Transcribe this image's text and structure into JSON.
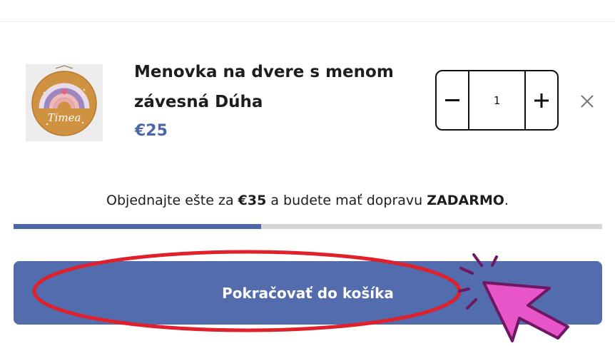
{
  "cart_item": {
    "image_lettering": "Timea",
    "title_line1": "Menovka na dvere s menom",
    "title_line2": "závesná Dúha",
    "price": "€25",
    "quantity": "1",
    "decrement_icon": "minus-icon",
    "increment_icon": "plus-icon",
    "remove_icon": "close-icon"
  },
  "shipping": {
    "prefix": "Objednajte ešte za ",
    "amount": "€35",
    "middle": " a budete mať dopravu ",
    "free_label": "ZADARMO",
    "suffix": ".",
    "progress_fraction": 0.42
  },
  "checkout_button": {
    "label": "Pokračovať do košíka"
  },
  "annotation": {
    "circle_color": "#e0202a",
    "cursor_color": "#e855c8",
    "cursor_icon": "pointer-cursor-icon"
  },
  "colors": {
    "accent": "#536cae",
    "price": "#4b67a8"
  }
}
